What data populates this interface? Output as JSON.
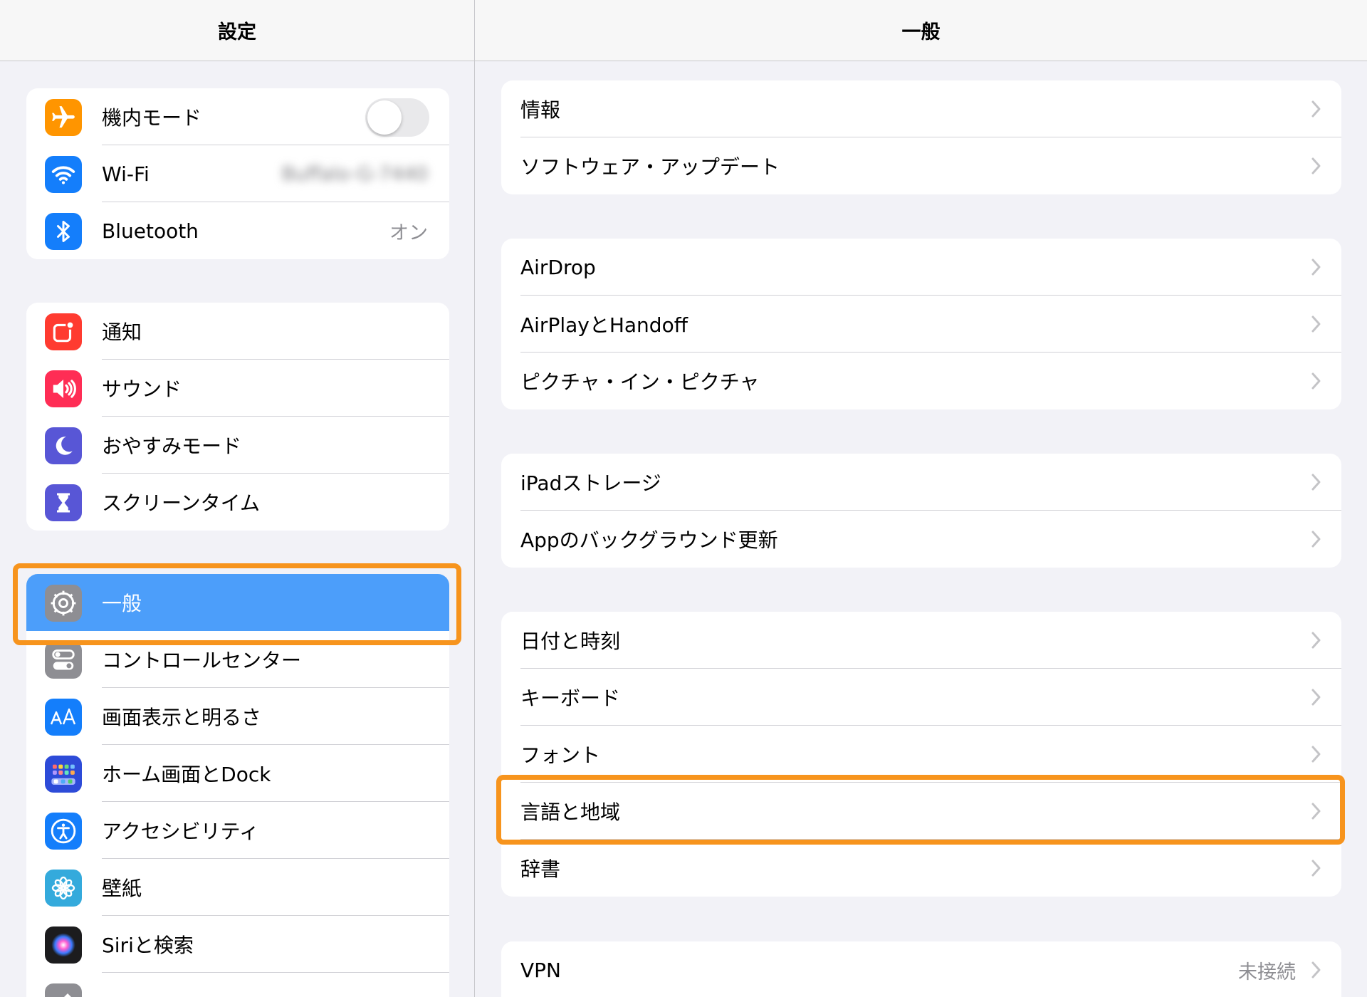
{
  "left_header": {
    "title": "設定"
  },
  "right_header": {
    "title": "一般"
  },
  "left_groups": [
    {
      "items": [
        {
          "name": "sidebar-item-airplane-mode",
          "icon": "airplane-icon",
          "icon_color": "#ff9500",
          "label": "機内モード",
          "toggle": false
        },
        {
          "name": "sidebar-item-wifi",
          "icon": "wifi-icon",
          "icon_color": "#147efb",
          "label": "Wi-Fi",
          "value": "Buffalo-G-7440"
        },
        {
          "name": "sidebar-item-bluetooth",
          "icon": "bluetooth-icon",
          "icon_color": "#147efb",
          "label": "Bluetooth",
          "value": "オン"
        }
      ]
    },
    {
      "items": [
        {
          "name": "sidebar-item-notifications",
          "icon": "notifications-icon",
          "icon_color": "#ff3b30",
          "label": "通知"
        },
        {
          "name": "sidebar-item-sounds",
          "icon": "speaker-icon",
          "icon_color": "#ff2d55",
          "label": "サウンド"
        },
        {
          "name": "sidebar-item-do-not-disturb",
          "icon": "moon-icon",
          "icon_color": "#5856d6",
          "label": "おやすみモード"
        },
        {
          "name": "sidebar-item-screen-time",
          "icon": "hourglass-icon",
          "icon_color": "#5856d6",
          "label": "スクリーンタイム"
        }
      ]
    },
    {
      "items": [
        {
          "name": "sidebar-item-general",
          "icon": "gear-icon",
          "icon_color": "#8e8e93",
          "label": "一般",
          "selected": true
        },
        {
          "name": "sidebar-item-control-center",
          "icon": "switches-icon",
          "icon_color": "#8e8e93",
          "label": "コントロールセンター"
        },
        {
          "name": "sidebar-item-display-brightness",
          "icon": "text-size-icon",
          "icon_color": "#147efb",
          "label": "画面表示と明るさ"
        },
        {
          "name": "sidebar-item-home-screen-dock",
          "icon": "app-grid-icon",
          "icon_color": "#2d4bd8",
          "label": "ホーム画面とDock"
        },
        {
          "name": "sidebar-item-accessibility",
          "icon": "accessibility-icon",
          "icon_color": "#147efb",
          "label": "アクセシビリティ"
        },
        {
          "name": "sidebar-item-wallpaper",
          "icon": "flower-icon",
          "icon_color": "#34aadc",
          "label": "壁紙"
        },
        {
          "name": "sidebar-item-siri-search",
          "icon": "siri-icon",
          "icon_color": "#1c1c1e",
          "label": "Siriと検索"
        },
        {
          "name": "sidebar-item-apple-pencil",
          "icon": "pencil-icon",
          "icon_color": "#8e8e93",
          "label": ""
        }
      ]
    }
  ],
  "right_groups": [
    {
      "items": [
        {
          "name": "row-about",
          "label": "情報"
        },
        {
          "name": "row-software-update",
          "label": "ソフトウェア・アップデート"
        }
      ]
    },
    {
      "items": [
        {
          "name": "row-airdrop",
          "label": "AirDrop"
        },
        {
          "name": "row-airplay-handoff",
          "label": "AirPlayとHandoff"
        },
        {
          "name": "row-picture-in-picture",
          "label": "ピクチャ・イン・ピクチャ"
        }
      ]
    },
    {
      "items": [
        {
          "name": "row-ipad-storage",
          "label": "iPadストレージ"
        },
        {
          "name": "row-background-app-refresh",
          "label": "Appのバックグラウンド更新"
        }
      ]
    },
    {
      "items": [
        {
          "name": "row-date-time",
          "label": "日付と時刻"
        },
        {
          "name": "row-keyboard",
          "label": "キーボード"
        },
        {
          "name": "row-fonts",
          "label": "フォント"
        },
        {
          "name": "row-language-region",
          "label": "言語と地域",
          "highlighted": true
        },
        {
          "name": "row-dictionary",
          "label": "辞書"
        }
      ]
    },
    {
      "items": [
        {
          "name": "row-vpn",
          "label": "VPN",
          "value": "未接続"
        }
      ]
    }
  ],
  "colors": {
    "accent_selected": "#4c9efa",
    "highlight": "#f7941d",
    "secondary_text": "#8e8e93"
  }
}
